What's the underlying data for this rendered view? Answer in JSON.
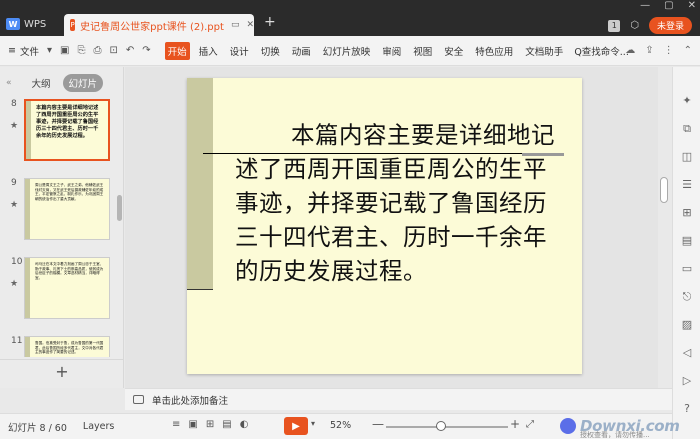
{
  "titlebar": {
    "app_tab": "WPS",
    "doc_tab": "史记鲁周公世家ppt课件 (2).ppt",
    "new_tab": "+",
    "badge": "1",
    "login": "未登录"
  },
  "menubar": {
    "file": "文件",
    "tabs": [
      "开始",
      "插入",
      "设计",
      "切换",
      "动画",
      "幻灯片放映",
      "审阅",
      "视图",
      "安全",
      "特色应用",
      "文档助手"
    ],
    "active_tab": 0,
    "search": "Q查找命令..."
  },
  "leftpanel": {
    "tab_outline": "大纲",
    "tab_slides": "幻灯片",
    "slides": [
      {
        "num": "8",
        "text": "本篇内容主要是详细地记述了西周开国重臣周公的生平事迹，并择要记载了鲁国经历三十四代君主、历时一千余年的历史发展过程。",
        "selected": true
      },
      {
        "num": "9",
        "text": "周公是周文王之子、武王之弟，他辅佐武王伐纣灭商，又在武王死后摄政辅佐年幼的成王，平定管蔡之乱，制礼作乐，为巩固周王朝的统治作出了重大贡献。",
        "selected": false
      },
      {
        "num": "10",
        "text": "司马迁在本文中着力刻画了周公忠于王室、勤于政事、礼贤下士的崇高品质，使其成为后世臣子的楷模。文章选材精当，详略得宜。",
        "selected": false
      },
      {
        "num": "11",
        "text": "鲁国。伯禽受封于鲁，成为鲁国的第一代国君，此后鲁国历经多代君主，文中对各代君主的事迹作了简要的记述。",
        "selected": false
      }
    ]
  },
  "slide": {
    "body": "本篇内容主要是详细地记述了西周开国重臣周公的生平事迹，并择要记载了鲁国经历三十四代君主、历时一千余年的历史发展过程。"
  },
  "notes": {
    "placeholder": "单击此处添加备注"
  },
  "statusbar": {
    "slide_info": "幻灯片 8 / 60",
    "layers": "Layers",
    "zoom": "52%",
    "zoom_level": 0.52
  },
  "watermark": {
    "text": "Downxi.com",
    "sub": "授权查看，请勿传播..."
  },
  "colors": {
    "accent": "#e8531f",
    "slide_bg": "#fcfbd7",
    "slide_bar": "#c9c9a0",
    "titlebar": "#2b2b2b"
  }
}
